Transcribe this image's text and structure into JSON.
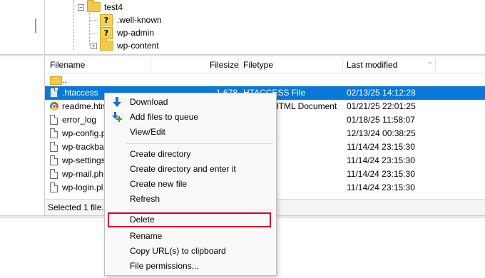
{
  "tree": {
    "items": [
      {
        "label": "test4",
        "type": "folder",
        "expander": "−"
      },
      {
        "label": ".well-known",
        "type": "unknown-folder",
        "badge": "?"
      },
      {
        "label": "wp-admin",
        "type": "unknown-folder",
        "badge": "?"
      },
      {
        "label": "wp-content",
        "type": "folder",
        "expander": "+"
      }
    ]
  },
  "list": {
    "columns": [
      "Filename",
      "Filesize",
      "Filetype",
      "Last modified"
    ],
    "rows": [
      {
        "name": "..",
        "size": "",
        "type": "",
        "modified": "",
        "icon": "folder-up"
      },
      {
        "name": ".htaccess",
        "size": "1,678",
        "type": "HTACCESS File",
        "modified": "02/13/25 14:12:28",
        "icon": "file-blue",
        "selected": true
      },
      {
        "name": "readme.htm",
        "size": "",
        "type": "e HTML Document",
        "modified": "01/21/25 22:01:25",
        "icon": "chrome"
      },
      {
        "name": "error_log",
        "size": "",
        "type": "",
        "modified": "01/18/25 11:58:07",
        "icon": "file"
      },
      {
        "name": "wp-config.p",
        "size": "",
        "type": "",
        "modified": "12/13/24 00:38:25",
        "icon": "file"
      },
      {
        "name": "wp-trackba",
        "size": "",
        "type": "",
        "modified": "11/14/24 23:15:30",
        "icon": "file"
      },
      {
        "name": "wp-settings",
        "size": "",
        "type": "",
        "modified": "11/14/24 23:15:30",
        "icon": "file"
      },
      {
        "name": "wp-mail.ph",
        "size": "",
        "type": "",
        "modified": "11/14/24 23:15:30",
        "icon": "file"
      },
      {
        "name": "wp-login.pl",
        "size": "",
        "type": "",
        "modified": "11/14/24 23:15:30",
        "icon": "file"
      }
    ]
  },
  "status": {
    "text": "Selected 1 file. T"
  },
  "menu": {
    "items": [
      {
        "label": "Download",
        "icon": "download-arrow-icon"
      },
      {
        "label": "Add files to queue",
        "icon": "add-to-queue-icon"
      },
      {
        "label": "View/Edit"
      },
      {
        "label": "Create directory"
      },
      {
        "label": "Create directory and enter it"
      },
      {
        "label": "Create new file"
      },
      {
        "label": "Refresh"
      },
      {
        "label": "Delete",
        "highlighted": true
      },
      {
        "label": "Rename"
      },
      {
        "label": "Copy URL(s) to clipboard"
      },
      {
        "label": "File permissions..."
      }
    ]
  },
  "colors": {
    "selection": "#0a78d7",
    "highlight_box": "#d5002e",
    "folder": "#f3c94d"
  }
}
